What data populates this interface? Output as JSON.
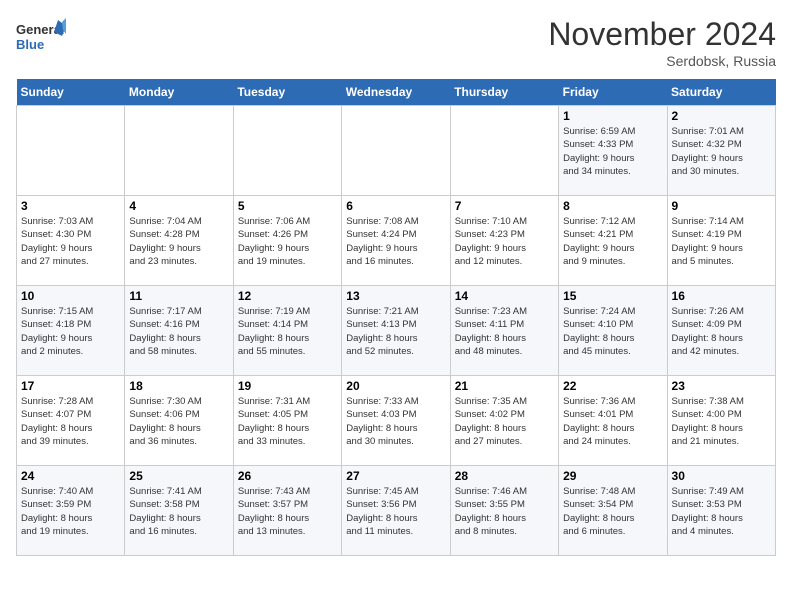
{
  "logo": {
    "line1": "General",
    "line2": "Blue"
  },
  "title": "November 2024",
  "location": "Serdobsk, Russia",
  "days_of_week": [
    "Sunday",
    "Monday",
    "Tuesday",
    "Wednesday",
    "Thursday",
    "Friday",
    "Saturday"
  ],
  "weeks": [
    [
      {
        "day": "",
        "info": ""
      },
      {
        "day": "",
        "info": ""
      },
      {
        "day": "",
        "info": ""
      },
      {
        "day": "",
        "info": ""
      },
      {
        "day": "",
        "info": ""
      },
      {
        "day": "1",
        "info": "Sunrise: 6:59 AM\nSunset: 4:33 PM\nDaylight: 9 hours\nand 34 minutes."
      },
      {
        "day": "2",
        "info": "Sunrise: 7:01 AM\nSunset: 4:32 PM\nDaylight: 9 hours\nand 30 minutes."
      }
    ],
    [
      {
        "day": "3",
        "info": "Sunrise: 7:03 AM\nSunset: 4:30 PM\nDaylight: 9 hours\nand 27 minutes."
      },
      {
        "day": "4",
        "info": "Sunrise: 7:04 AM\nSunset: 4:28 PM\nDaylight: 9 hours\nand 23 minutes."
      },
      {
        "day": "5",
        "info": "Sunrise: 7:06 AM\nSunset: 4:26 PM\nDaylight: 9 hours\nand 19 minutes."
      },
      {
        "day": "6",
        "info": "Sunrise: 7:08 AM\nSunset: 4:24 PM\nDaylight: 9 hours\nand 16 minutes."
      },
      {
        "day": "7",
        "info": "Sunrise: 7:10 AM\nSunset: 4:23 PM\nDaylight: 9 hours\nand 12 minutes."
      },
      {
        "day": "8",
        "info": "Sunrise: 7:12 AM\nSunset: 4:21 PM\nDaylight: 9 hours\nand 9 minutes."
      },
      {
        "day": "9",
        "info": "Sunrise: 7:14 AM\nSunset: 4:19 PM\nDaylight: 9 hours\nand 5 minutes."
      }
    ],
    [
      {
        "day": "10",
        "info": "Sunrise: 7:15 AM\nSunset: 4:18 PM\nDaylight: 9 hours\nand 2 minutes."
      },
      {
        "day": "11",
        "info": "Sunrise: 7:17 AM\nSunset: 4:16 PM\nDaylight: 8 hours\nand 58 minutes."
      },
      {
        "day": "12",
        "info": "Sunrise: 7:19 AM\nSunset: 4:14 PM\nDaylight: 8 hours\nand 55 minutes."
      },
      {
        "day": "13",
        "info": "Sunrise: 7:21 AM\nSunset: 4:13 PM\nDaylight: 8 hours\nand 52 minutes."
      },
      {
        "day": "14",
        "info": "Sunrise: 7:23 AM\nSunset: 4:11 PM\nDaylight: 8 hours\nand 48 minutes."
      },
      {
        "day": "15",
        "info": "Sunrise: 7:24 AM\nSunset: 4:10 PM\nDaylight: 8 hours\nand 45 minutes."
      },
      {
        "day": "16",
        "info": "Sunrise: 7:26 AM\nSunset: 4:09 PM\nDaylight: 8 hours\nand 42 minutes."
      }
    ],
    [
      {
        "day": "17",
        "info": "Sunrise: 7:28 AM\nSunset: 4:07 PM\nDaylight: 8 hours\nand 39 minutes."
      },
      {
        "day": "18",
        "info": "Sunrise: 7:30 AM\nSunset: 4:06 PM\nDaylight: 8 hours\nand 36 minutes."
      },
      {
        "day": "19",
        "info": "Sunrise: 7:31 AM\nSunset: 4:05 PM\nDaylight: 8 hours\nand 33 minutes."
      },
      {
        "day": "20",
        "info": "Sunrise: 7:33 AM\nSunset: 4:03 PM\nDaylight: 8 hours\nand 30 minutes."
      },
      {
        "day": "21",
        "info": "Sunrise: 7:35 AM\nSunset: 4:02 PM\nDaylight: 8 hours\nand 27 minutes."
      },
      {
        "day": "22",
        "info": "Sunrise: 7:36 AM\nSunset: 4:01 PM\nDaylight: 8 hours\nand 24 minutes."
      },
      {
        "day": "23",
        "info": "Sunrise: 7:38 AM\nSunset: 4:00 PM\nDaylight: 8 hours\nand 21 minutes."
      }
    ],
    [
      {
        "day": "24",
        "info": "Sunrise: 7:40 AM\nSunset: 3:59 PM\nDaylight: 8 hours\nand 19 minutes."
      },
      {
        "day": "25",
        "info": "Sunrise: 7:41 AM\nSunset: 3:58 PM\nDaylight: 8 hours\nand 16 minutes."
      },
      {
        "day": "26",
        "info": "Sunrise: 7:43 AM\nSunset: 3:57 PM\nDaylight: 8 hours\nand 13 minutes."
      },
      {
        "day": "27",
        "info": "Sunrise: 7:45 AM\nSunset: 3:56 PM\nDaylight: 8 hours\nand 11 minutes."
      },
      {
        "day": "28",
        "info": "Sunrise: 7:46 AM\nSunset: 3:55 PM\nDaylight: 8 hours\nand 8 minutes."
      },
      {
        "day": "29",
        "info": "Sunrise: 7:48 AM\nSunset: 3:54 PM\nDaylight: 8 hours\nand 6 minutes."
      },
      {
        "day": "30",
        "info": "Sunrise: 7:49 AM\nSunset: 3:53 PM\nDaylight: 8 hours\nand 4 minutes."
      }
    ]
  ]
}
